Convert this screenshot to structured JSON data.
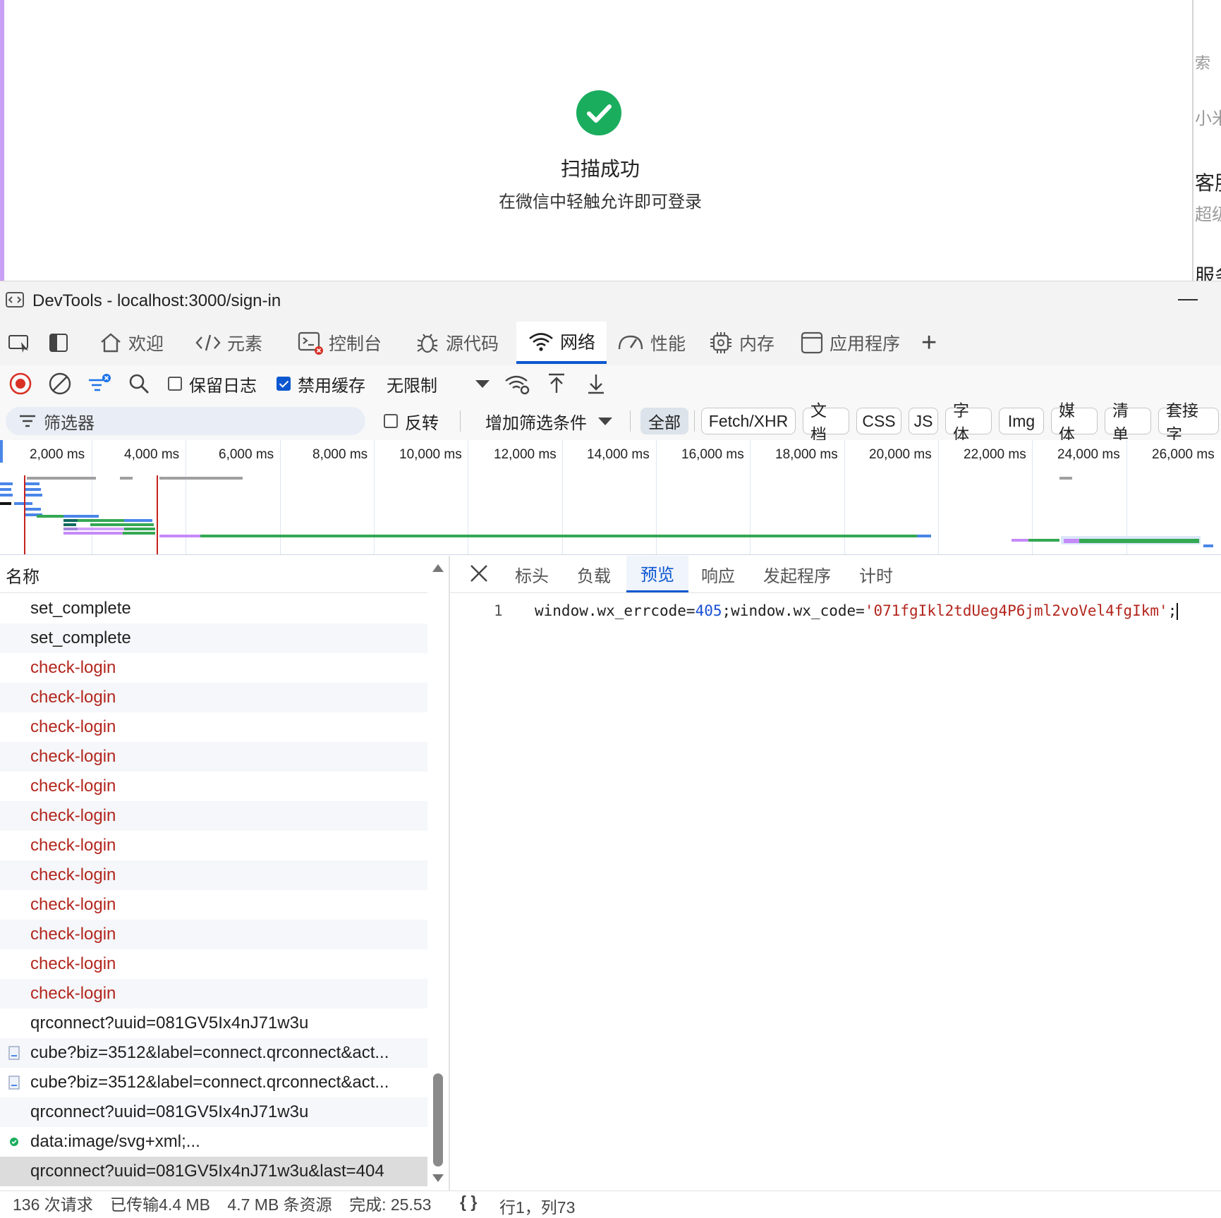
{
  "page": {
    "scan_title": "扫描成功",
    "scan_subtitle": "在微信中轻触允许即可登录",
    "side_texts": [
      "索",
      "小米",
      "客服",
      "超级",
      "服务"
    ]
  },
  "devtools": {
    "title": "DevTools - localhost:3000/sign-in",
    "minimize_glyph": "—"
  },
  "tabs": [
    {
      "label": "欢迎",
      "icon": "home-icon"
    },
    {
      "label": "元素",
      "icon": "code-icon"
    },
    {
      "label": "控制台",
      "icon": "console-icon"
    },
    {
      "label": "源代码",
      "icon": "bug-icon"
    },
    {
      "label": "网络",
      "icon": "wifi-icon",
      "active": true
    },
    {
      "label": "性能",
      "icon": "gauge-icon"
    },
    {
      "label": "内存",
      "icon": "chip-icon"
    },
    {
      "label": "应用程序",
      "icon": "app-icon"
    },
    {
      "label": "+",
      "icon": "plus-icon"
    }
  ],
  "toolbar": {
    "preserve_log": "保留日志",
    "preserve_log_checked": false,
    "disable_cache": "禁用缓存",
    "disable_cache_checked": true,
    "throttle": "无限制"
  },
  "filterbar": {
    "filter_placeholder": "筛选器",
    "invert": "反转",
    "more_filters": "增加筛选条件",
    "chips": [
      "全部",
      "Fetch/XHR",
      "文档",
      "CSS",
      "JS",
      "字体",
      "Img",
      "媒体",
      "清单",
      "套接字"
    ],
    "selected_chip": "全部"
  },
  "timeline": {
    "ticks": [
      "2,000 ms",
      "4,000 ms",
      "6,000 ms",
      "8,000 ms",
      "10,000 ms",
      "12,000 ms",
      "14,000 ms",
      "16,000 ms",
      "18,000 ms",
      "20,000 ms",
      "22,000 ms",
      "24,000 ms",
      "26,000 ms"
    ],
    "colors": {
      "blue": "#4a86e8",
      "green": "#34a853",
      "purple": "#c58af9",
      "gray": "#a0a0a0",
      "red": "#c5221f",
      "teal": "#0f6a5c"
    }
  },
  "list": {
    "header": "名称",
    "rows": [
      {
        "name": "set_complete",
        "style": "normal",
        "icon": ""
      },
      {
        "name": "set_complete",
        "style": "normal",
        "icon": ""
      },
      {
        "name": "check-login",
        "style": "error",
        "icon": ""
      },
      {
        "name": "check-login",
        "style": "error",
        "icon": ""
      },
      {
        "name": "check-login",
        "style": "error",
        "icon": ""
      },
      {
        "name": "check-login",
        "style": "error",
        "icon": ""
      },
      {
        "name": "check-login",
        "style": "error",
        "icon": ""
      },
      {
        "name": "check-login",
        "style": "error",
        "icon": ""
      },
      {
        "name": "check-login",
        "style": "error",
        "icon": ""
      },
      {
        "name": "check-login",
        "style": "error",
        "icon": ""
      },
      {
        "name": "check-login",
        "style": "error",
        "icon": ""
      },
      {
        "name": "check-login",
        "style": "error",
        "icon": ""
      },
      {
        "name": "check-login",
        "style": "error",
        "icon": ""
      },
      {
        "name": "check-login",
        "style": "error",
        "icon": ""
      },
      {
        "name": "qrconnect?uuid=081GV5Ix4nJ71w3u",
        "style": "normal",
        "icon": ""
      },
      {
        "name": "cube?biz=3512&label=connect.qrconnect&act...",
        "style": "normal",
        "icon": "file-icon"
      },
      {
        "name": "cube?biz=3512&label=connect.qrconnect&act...",
        "style": "normal",
        "icon": "file-icon"
      },
      {
        "name": "qrconnect?uuid=081GV5Ix4nJ71w3u",
        "style": "normal",
        "icon": ""
      },
      {
        "name": "data:image/svg+xml;...",
        "style": "normal",
        "icon": "green-dot-icon"
      },
      {
        "name": "qrconnect?uuid=081GV5Ix4nJ71w3u&last=404",
        "style": "selected",
        "icon": ""
      }
    ]
  },
  "detail": {
    "tabs": [
      "标头",
      "负载",
      "预览",
      "响应",
      "发起程序",
      "计时"
    ],
    "active_tab": "预览",
    "line_number": "1",
    "code": {
      "part1": "window.wx_errcode=",
      "num": "405",
      "part2": ";window.wx_code=",
      "str": "'071fgIkl2tdUeg4P6jml2voVel4fgIkm'",
      "part3": ";"
    }
  },
  "status": {
    "requests": "136 次请求",
    "transferred": "已传输4.4 MB",
    "resources": "4.7 MB 条资源",
    "finish": "完成: 25.53",
    "pretty_print": "{ }",
    "position": "行1，列73"
  }
}
